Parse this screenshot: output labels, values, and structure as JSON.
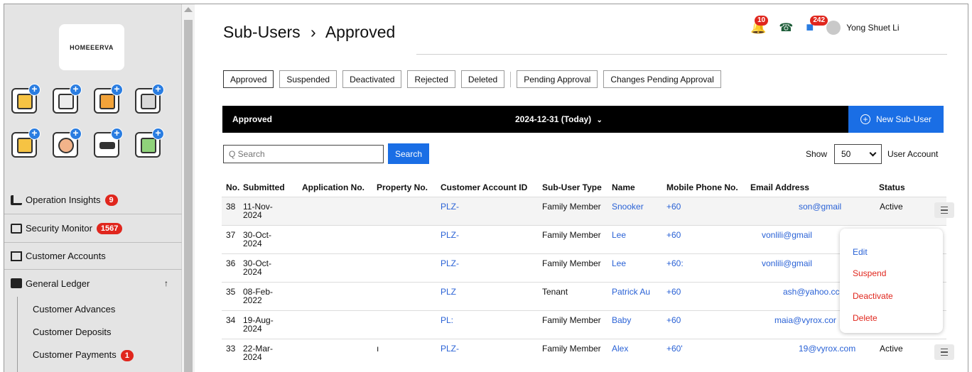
{
  "sidebar": {
    "logo_text": "HOMEEERVA",
    "tile_icons": [
      "id-card-icon",
      "calendar-icon",
      "bank-icon",
      "services-icon",
      "card-key-icon",
      "person-icon",
      "tag-icon",
      "profile-card-icon"
    ],
    "menu": [
      {
        "label": "Operation Insights",
        "badge": "9",
        "icon": "bar-chart-icon"
      },
      {
        "label": "Security Monitor",
        "badge": "1567",
        "icon": "camera-icon"
      },
      {
        "label": "Customer Accounts",
        "badge": "",
        "icon": "home-icon"
      },
      {
        "label": "General Ledger",
        "badge": "",
        "icon": "ledger-icon",
        "caret": "↑"
      }
    ],
    "submenu": [
      {
        "label": "Customer Advances",
        "badge": ""
      },
      {
        "label": "Customer Deposits",
        "badge": ""
      },
      {
        "label": "Customer Payments",
        "badge": "1"
      }
    ]
  },
  "header": {
    "title": "Sub-Users",
    "separator": "›",
    "subtitle": "Approved",
    "notification_count": "10",
    "message_count": "242",
    "user_name": "Yong Shuet Li"
  },
  "tabs": [
    "Approved",
    "Suspended",
    "Deactivated",
    "Rejected",
    "Deleted",
    "Pending Approval",
    "Changes Pending Approval"
  ],
  "bar": {
    "label": "Approved",
    "date": "2024-12-31 (Today)",
    "date_caret": "⌄",
    "new_button": "New Sub-User"
  },
  "search": {
    "placeholder": "Q Search",
    "button": "Search"
  },
  "show": {
    "label": "Show",
    "value": "50",
    "suffix": "User Account"
  },
  "table": {
    "headers": [
      "No.",
      "Submitted",
      "Application No.",
      "Property No.",
      "Customer Account ID",
      "Sub-User Type",
      "Name",
      "Mobile Phone No.",
      "Email Address",
      "Status"
    ],
    "rows": [
      {
        "no": "38",
        "date1": "11-Nov-",
        "date2": "2024",
        "app": "",
        "prop": "",
        "acct": "PLZ-",
        "type": "Family Member",
        "name": "Snooker",
        "phone": "+60",
        "email": "son@gmail",
        "status": "Active"
      },
      {
        "no": "37",
        "date1": "30-Oct-",
        "date2": "2024",
        "app": "",
        "prop": "",
        "acct": "PLZ-",
        "type": "Family Member",
        "name": "Lee",
        "phone": "+60",
        "email": "vonlili@gmail",
        "status": ""
      },
      {
        "no": "36",
        "date1": "30-Oct-",
        "date2": "2024",
        "app": "",
        "prop": "",
        "acct": "PLZ-",
        "type": "Family Member",
        "name": "Lee",
        "phone": "+60:",
        "email": "vonlili@gmail",
        "status": ""
      },
      {
        "no": "35",
        "date1": "08-Feb-",
        "date2": "2022",
        "app": "",
        "prop": "",
        "acct": "PLZ",
        "type": "Tenant",
        "name": "Patrick Au",
        "phone": "+60",
        "email": "ash@yahoo.cc",
        "status": ""
      },
      {
        "no": "34",
        "date1": "19-Aug-",
        "date2": "2024",
        "app": "",
        "prop": "",
        "acct": "PL:",
        "type": "Family Member",
        "name": "Baby",
        "phone": "+60",
        "email": "maia@vyrox.cor",
        "status": ""
      },
      {
        "no": "33",
        "date1": "22-Mar-",
        "date2": "2024",
        "app": "",
        "prop": "ı",
        "acct": "PLZ-",
        "type": "Family Member",
        "name": "Alex",
        "phone": "+60'",
        "email": "19@vyrox.com",
        "status": "Active"
      }
    ]
  },
  "popup": [
    "Edit",
    "Suspend",
    "Deactivate",
    "Delete"
  ],
  "colors": {
    "accent": "#1a6ee5",
    "badge": "#e0261d",
    "link": "#2a62d6"
  }
}
